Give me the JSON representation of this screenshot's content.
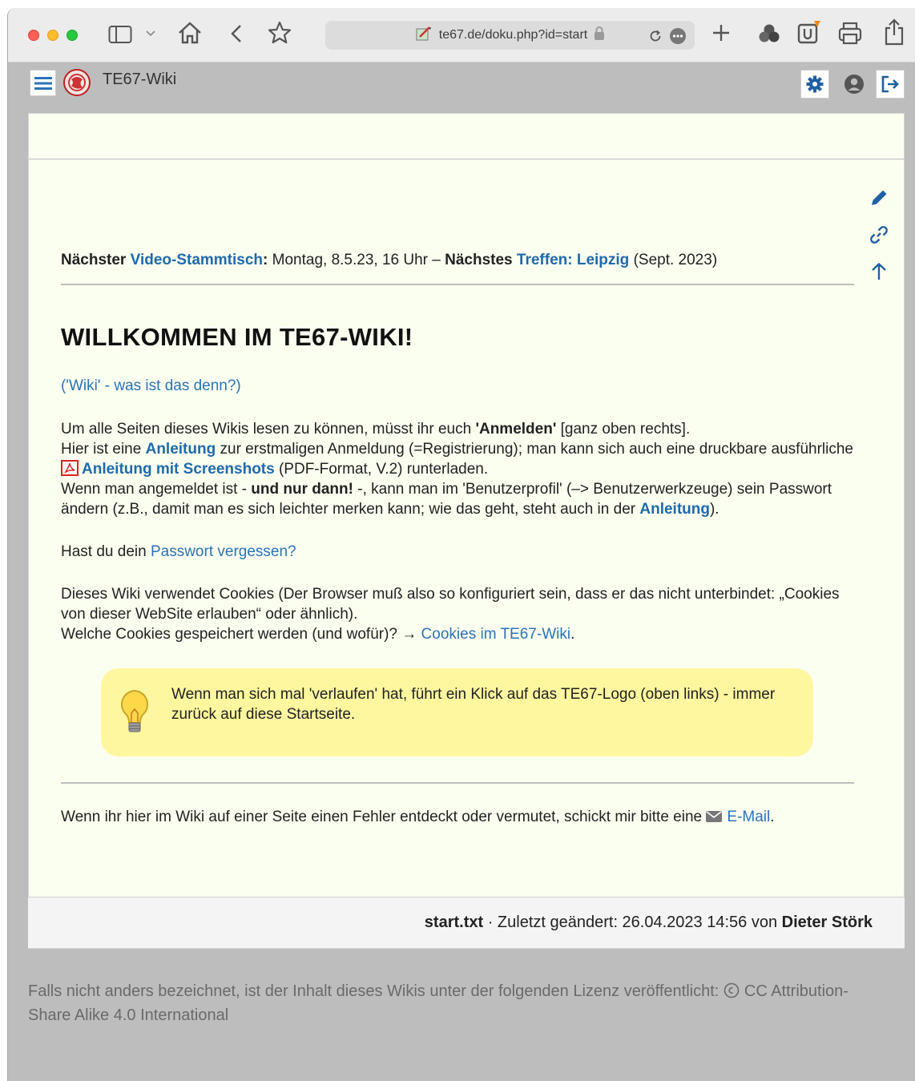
{
  "browser": {
    "url": "te67.de/doku.php?id=start"
  },
  "header": {
    "site_title": "TE67-Wiki"
  },
  "announcement": {
    "prefix_bold": "Nächster",
    "link1": "Video-Stammtisch",
    "colon": ":",
    "text1": " Montag, 8.5.23, 16 Uhr – ",
    "bold2": "Nächstes",
    "link2": "Treffen: Leipzig",
    "text2": " (Sept. 2023)"
  },
  "main": {
    "heading": "WILLKOMMEN IM TE67-WIKI!",
    "wiki_link": "('Wiki' - was ist das denn?)",
    "p1": {
      "t1": "Um alle Seiten dieses Wikis lesen zu können, müsst ihr euch ",
      "b1": "'Anmelden'",
      "t2": " [ganz oben rechts].",
      "t3": "Hier ist eine ",
      "link_anleitung": "Anleitung",
      "t4": " zur erstmaligen Anmeldung (=Registrierung); man kann sich auch eine druckbare ausführliche ",
      "link_pdf": "Anleitung mit Screenshots",
      "t5": " (PDF-Format, V.2) runterladen.",
      "t6": "Wenn man angemeldet ist - ",
      "b2": "und nur dann!",
      "t7": " -, kann man im 'Benutzerprofil' (–> Benutzerwerkzeuge) sein Passwort ändern (z.B., damit man es sich leichter merken kann; wie das geht, steht auch in der ",
      "link_anleitung2": "Anleitung",
      "t8": ")."
    },
    "p2": {
      "t1": "Hast du dein ",
      "link": "Passwort vergessen?"
    },
    "p3": {
      "t1": "Dieses Wiki verwendet Cookies (Der Browser muß also so konfiguriert sein, dass er das nicht unterbindet: „Cookies von dieser WebSite erlauben“ oder ähnlich).",
      "t2": "Welche Cookies gespeichert werden (und wofür)? → ",
      "link": "Cookies im TE67-Wiki",
      "t3": "."
    },
    "tip": "Wenn man sich mal 'verlaufen' hat, führt ein Klick auf das TE67-Logo (oben links) - immer zurück auf diese Startseite.",
    "p4": {
      "t1": "Wenn ihr hier im Wiki auf einer Seite einen Fehler entdeckt oder vermutet, schickt mir bitte eine ",
      "link": "E-Mail",
      "t2": "."
    }
  },
  "docinfo": {
    "filename": "start.txt",
    "text": " · Zuletzt geändert: 26.04.2023 14:56 von ",
    "author": "Dieter Störk"
  },
  "license": {
    "text": "Falls nicht anders bezeichnet, ist der Inhalt dieses Wikis unter der folgenden Lizenz veröffentlicht: ",
    "link": "CC Attribution-Share Alike 4.0 International"
  }
}
